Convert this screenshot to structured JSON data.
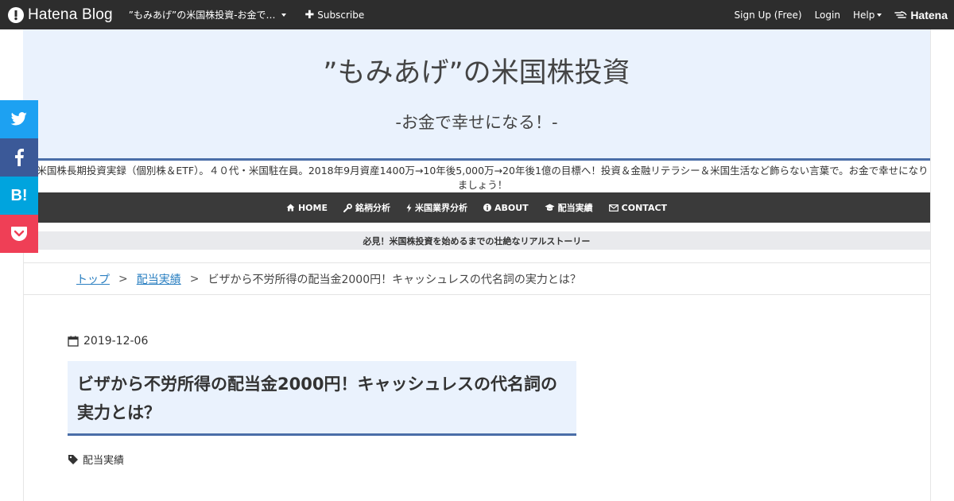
{
  "topbar": {
    "logo_text": "Hatena Blog",
    "blog_selector": "”もみあげ”の米国株投資-お金で…",
    "subscribe_label": "Subscribe",
    "signup_label": "Sign Up (Free)",
    "login_label": "Login",
    "help_label": "Help",
    "hatena_label": "Hatena"
  },
  "header": {
    "title": "”もみあげ”の米国株投資",
    "subtitle": "-お金で幸せになる！-",
    "description": "米国株長期投資実録（個別株＆ETF）。４０代・米国駐在員。2018年9月資産1400万→10年後5,000万→20年後1億の目標へ！投資＆金融リテラシー＆米国生活など飾らない言葉で。お金で幸せになりましょう！"
  },
  "nav": {
    "items": [
      {
        "label": "HOME",
        "icon": "home-icon"
      },
      {
        "label": "銘柄分析",
        "icon": "wrench-icon"
      },
      {
        "label": "米国業界分析",
        "icon": "bolt-icon"
      },
      {
        "label": "ABOUT",
        "icon": "info-icon"
      },
      {
        "label": "配当実績",
        "icon": "graduation-cap-icon"
      },
      {
        "label": "CONTACT",
        "icon": "envelope-icon"
      }
    ]
  },
  "banner": {
    "text": "必見！米国株投資を始めるまでの壮絶なリアルストーリー"
  },
  "breadcrumb": {
    "items": [
      "トップ",
      "配当実績"
    ],
    "current": "ビザから不労所得の配当金2000円！キャッシュレスの代名詞の実力とは？",
    "separator": ">"
  },
  "share": {
    "buttons": [
      "twitter-icon",
      "facebook-icon",
      "hatena-bookmark-icon",
      "pocket-icon"
    ],
    "hatena_bookmark_text": "B!"
  },
  "article": {
    "date": "2019-12-06",
    "title": "ビザから不労所得の配当金2000円！キャッシュレスの代名詞の実力とは？",
    "category": "配当実績"
  },
  "colors": {
    "topbar_bg": "#2d2d2d",
    "header_bg": "#eaf2fd",
    "accent": "#4a6ea8",
    "nav_bg": "#3a3a3a",
    "link": "#2a7fc1",
    "twitter": "#1da1f2",
    "facebook": "#3b5998",
    "hatena_bookmark": "#00a4de",
    "pocket": "#ef3f56"
  }
}
